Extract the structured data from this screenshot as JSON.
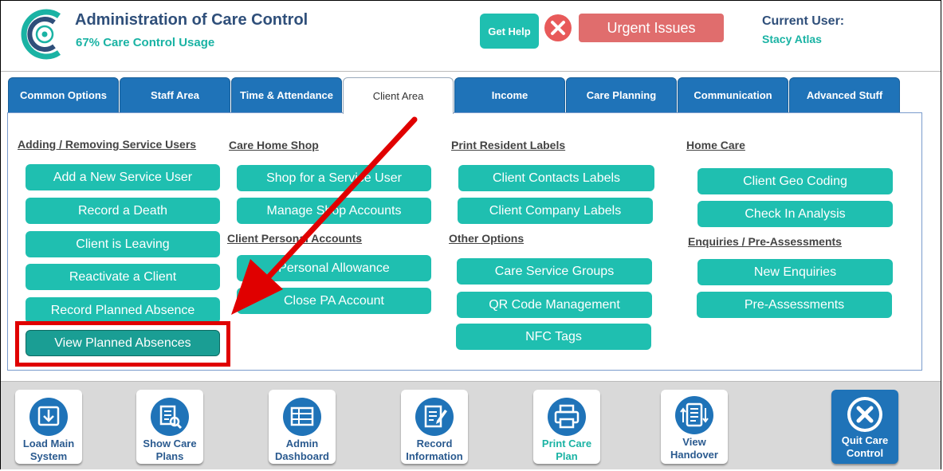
{
  "header": {
    "title": "Administration of Care Control",
    "usage": "67% Care Control Usage",
    "help_label": "Get Help",
    "urgent_label": "Urgent Issues",
    "user_label": "Current User:",
    "user_name": "Stacy Atlas"
  },
  "tabs": [
    {
      "label": "Common Options",
      "active": false
    },
    {
      "label": "Staff Area",
      "active": false
    },
    {
      "label": "Time & Attendance",
      "active": false
    },
    {
      "label": "Client Area",
      "active": true
    },
    {
      "label": "Income",
      "active": false
    },
    {
      "label": "Care Planning",
      "active": false
    },
    {
      "label": "Communication",
      "active": false
    },
    {
      "label": "Advanced Stuff",
      "active": false
    }
  ],
  "sections": {
    "adding": {
      "title": "Adding / Removing Service Users",
      "buttons": [
        "Add a New Service User",
        "Record a Death",
        "Client is Leaving",
        "Reactivate a Client",
        "Record Planned Absence",
        "View Planned Absences"
      ]
    },
    "shop": {
      "title": "Care Home Shop",
      "buttons": [
        "Shop for a Service User",
        "Manage Shop Accounts"
      ]
    },
    "personal": {
      "title": "Client Personal Accounts",
      "buttons": [
        "Personal Allowance",
        "Close PA Account"
      ]
    },
    "labels": {
      "title": "Print Resident Labels",
      "buttons": [
        "Client Contacts Labels",
        "Client Company Labels"
      ]
    },
    "other": {
      "title": "Other Options",
      "buttons": [
        "Care Service Groups",
        "QR Code Management",
        "NFC Tags"
      ]
    },
    "homecare": {
      "title": "Home Care",
      "buttons": [
        "Client Geo Coding",
        "Check In Analysis"
      ]
    },
    "enquiries": {
      "title": "Enquiries / Pre-Assessments",
      "buttons": [
        "New Enquiries",
        "Pre-Assessments"
      ]
    }
  },
  "bottom": [
    {
      "label1": "Load Main",
      "label2": "System",
      "icon": "load-system-icon"
    },
    {
      "label1": "Show Care",
      "label2": "Plans",
      "icon": "show-care-plans-icon"
    },
    {
      "label1": "Admin",
      "label2": "Dashboard",
      "icon": "dashboard-icon"
    },
    {
      "label1": "Record",
      "label2": "Information",
      "icon": "record-information-icon"
    },
    {
      "label1": "Print Care",
      "label2": "Plan",
      "icon": "printer-icon"
    },
    {
      "label1": "View",
      "label2": "Handover",
      "icon": "handover-icon"
    },
    {
      "label1": "Quit Care",
      "label2": "Control",
      "icon": "quit-icon"
    }
  ],
  "colors": {
    "teal": "#1fbfb0",
    "blue": "#1f73b8",
    "urgent": "#e06d6d",
    "highlight": "#e00000"
  }
}
